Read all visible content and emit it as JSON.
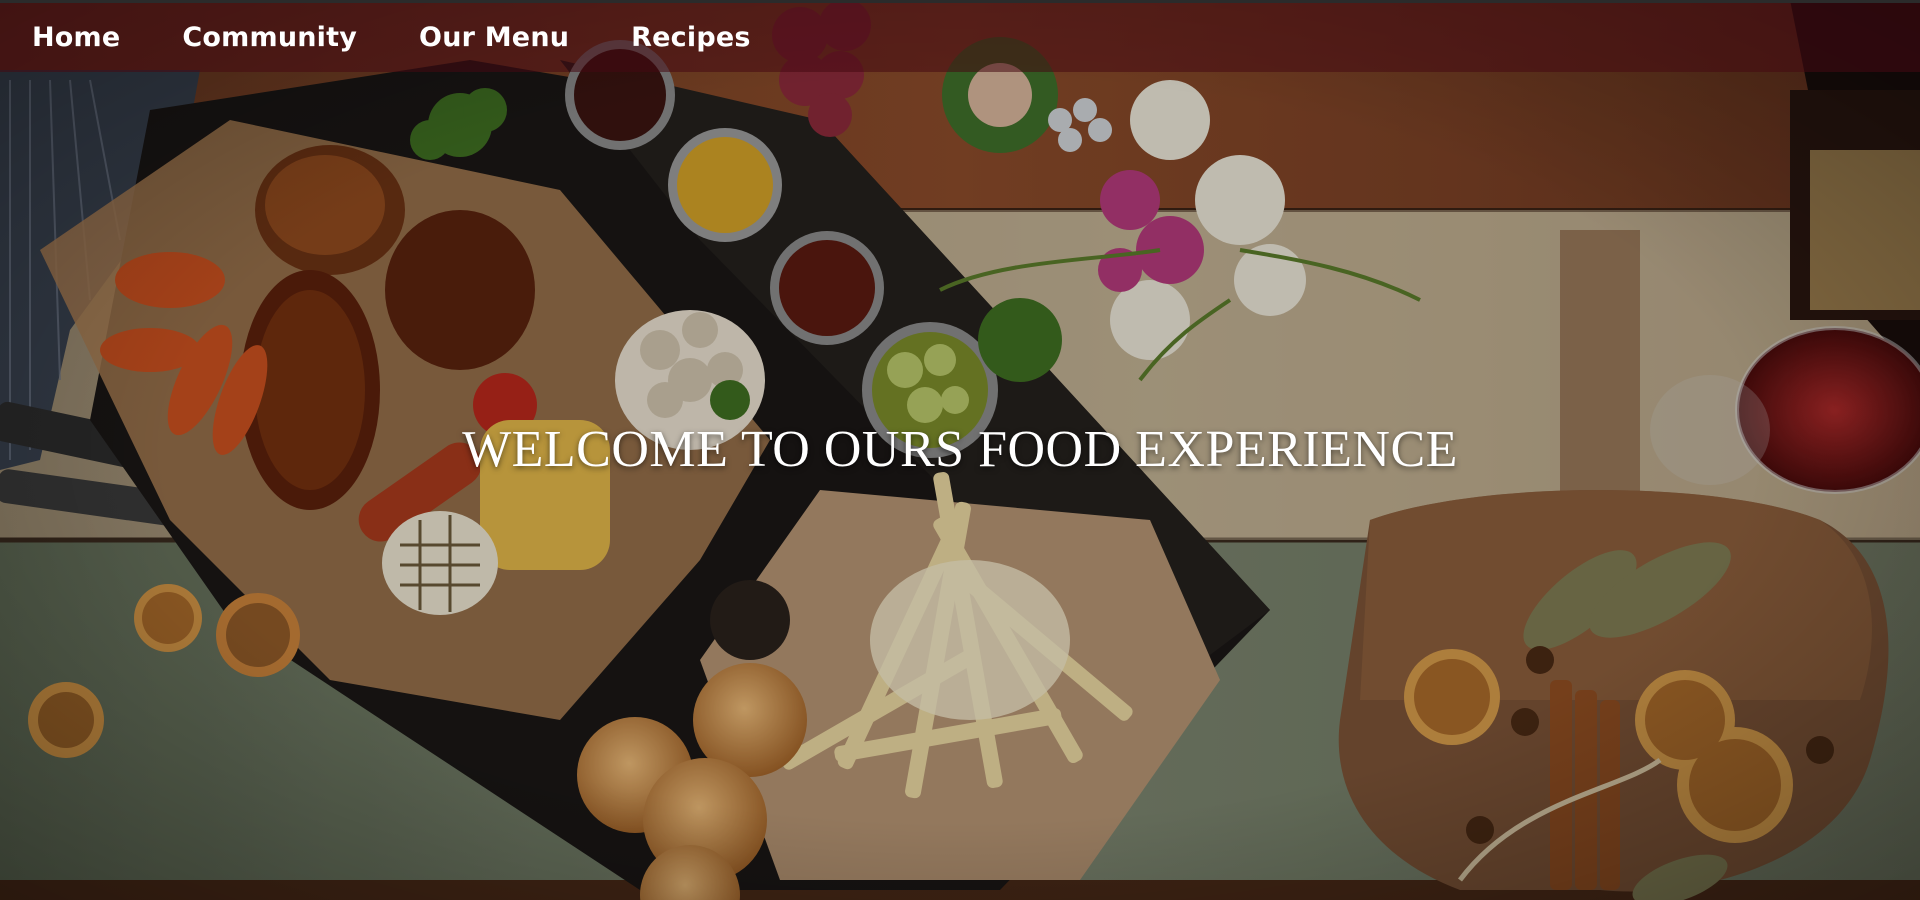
{
  "nav": {
    "items": [
      {
        "label": "Home"
      },
      {
        "label": "Community"
      },
      {
        "label": "Our Menu"
      },
      {
        "label": "Recipes"
      }
    ]
  },
  "hero": {
    "headline": "WELCOME TO OURS FOOD EXPERIENCE"
  },
  "colors": {
    "nav_background": "#460A12",
    "headline_text": "#FFFFFF",
    "wood_table": "#7A4A2A"
  }
}
